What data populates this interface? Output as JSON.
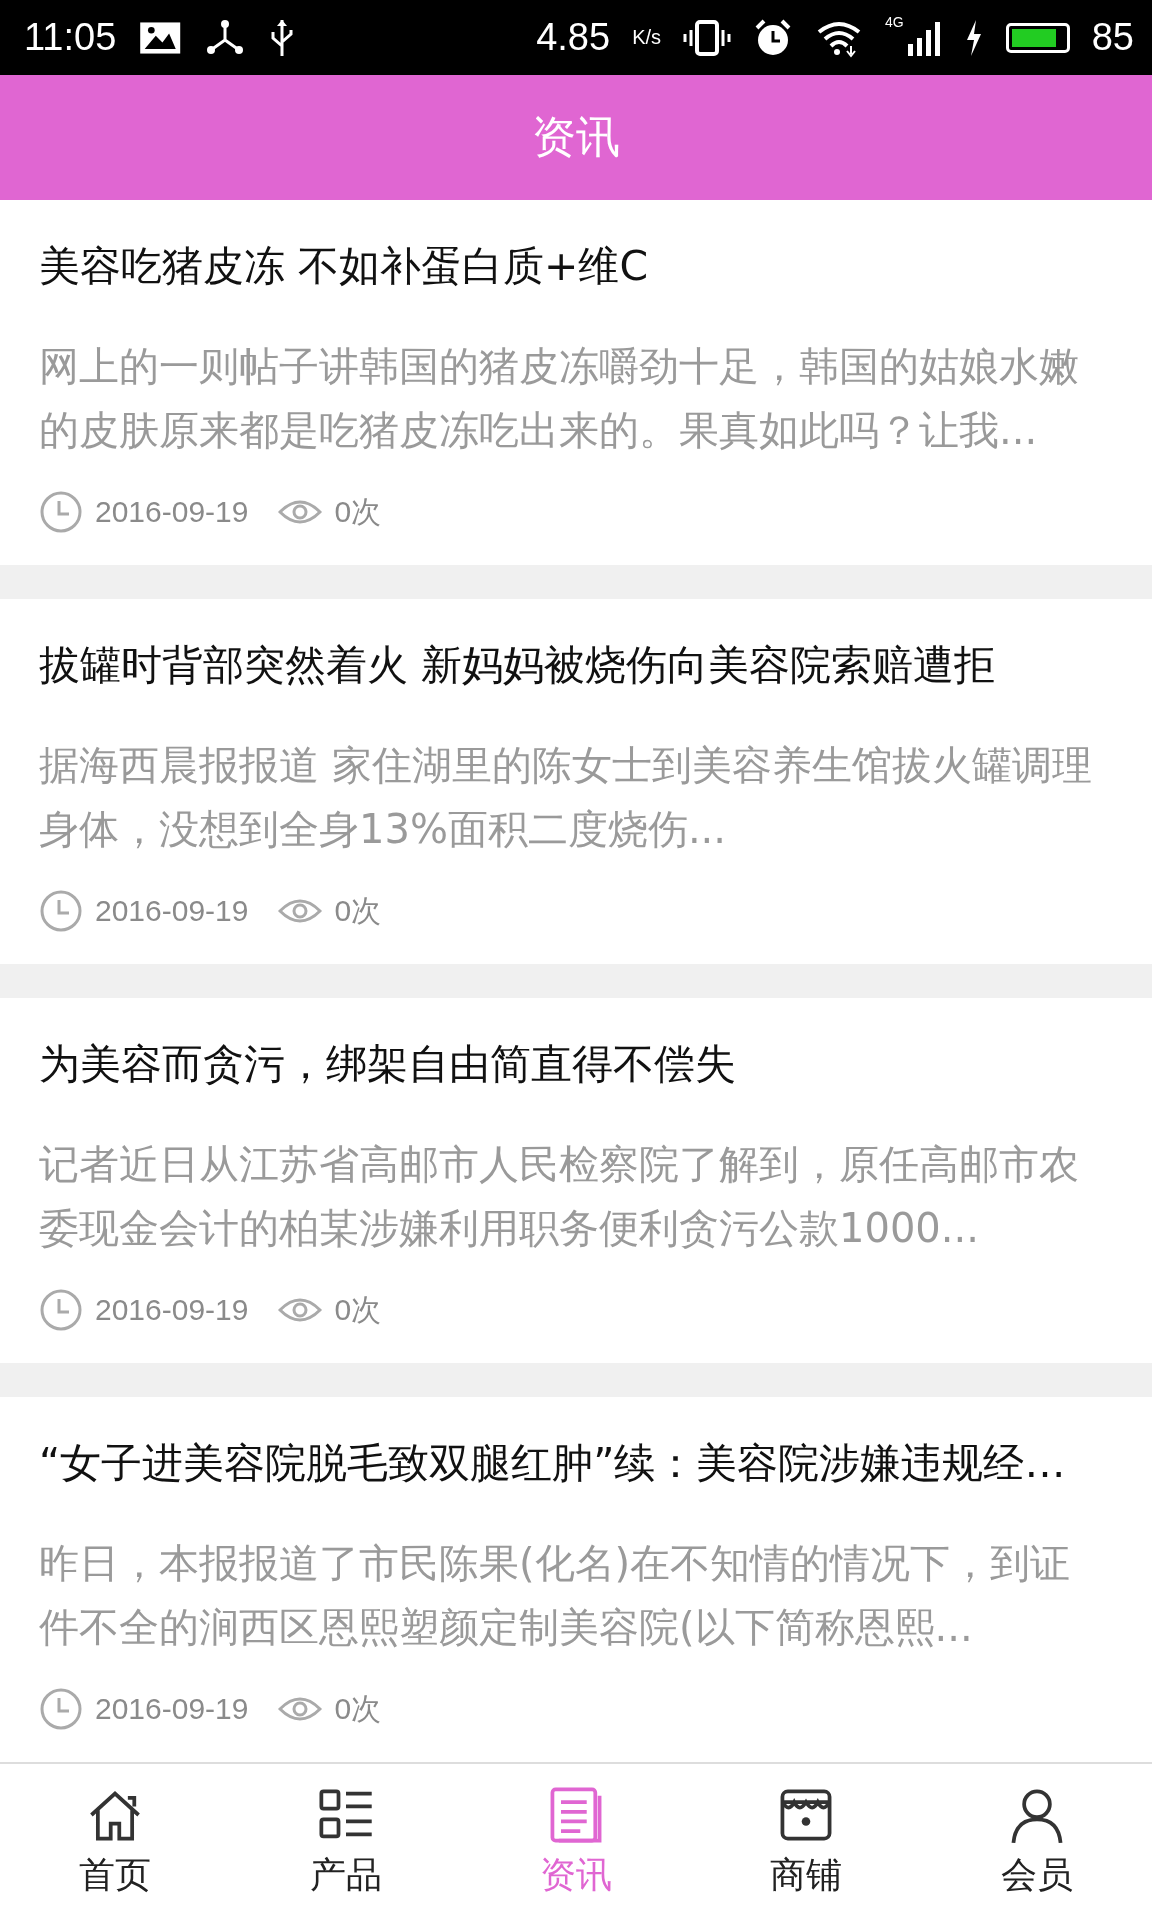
{
  "status_bar": {
    "time": "11:05",
    "speed": "4.85",
    "speed_unit": "K/s",
    "network": "4G",
    "battery": "85"
  },
  "header": {
    "title": "资讯"
  },
  "articles": [
    {
      "title": "美容吃猪皮冻 不如补蛋白质+维C",
      "summary": "网上的一则帖子讲韩国的猪皮冻嚼劲十足，韩国的姑娘水嫩的皮肤原来都是吃猪皮冻吃出来的。果真如此吗？让我...",
      "date": "2016-09-19",
      "views": "0次"
    },
    {
      "title": "拔罐时背部突然着火 新妈妈被烧伤向美容院索赔遭拒",
      "summary": "据海西晨报报道  家住湖里的陈女士到美容养生馆拔火罐调理身体，没想到全身13%面积二度烧伤...",
      "date": "2016-09-19",
      "views": "0次"
    },
    {
      "title": "为美容而贪污，绑架自由简直得不偿失",
      "summary": "记者近日从江苏省高邮市人民检察院了解到，原任高邮市农委现金会计的柏某涉嫌利用职务便利贪污公款1000...",
      "date": "2016-09-19",
      "views": "0次"
    },
    {
      "title": "“女子进美容院脱毛致双腿红肿”续：美容院涉嫌违规经…",
      "summary": "昨日，本报报道了市民陈果(化名)在不知情的情况下，到证件不全的涧西区恩熙塑颜定制美容院(以下简称恩熙...",
      "date": "2016-09-19",
      "views": "0次"
    }
  ],
  "nav": [
    {
      "label": "首页",
      "kind": "home",
      "selected": false
    },
    {
      "label": "产品",
      "kind": "products",
      "selected": false
    },
    {
      "label": "资讯",
      "kind": "news",
      "selected": true
    },
    {
      "label": "商铺",
      "kind": "shop",
      "selected": false
    },
    {
      "label": "会员",
      "kind": "member",
      "selected": false
    }
  ]
}
